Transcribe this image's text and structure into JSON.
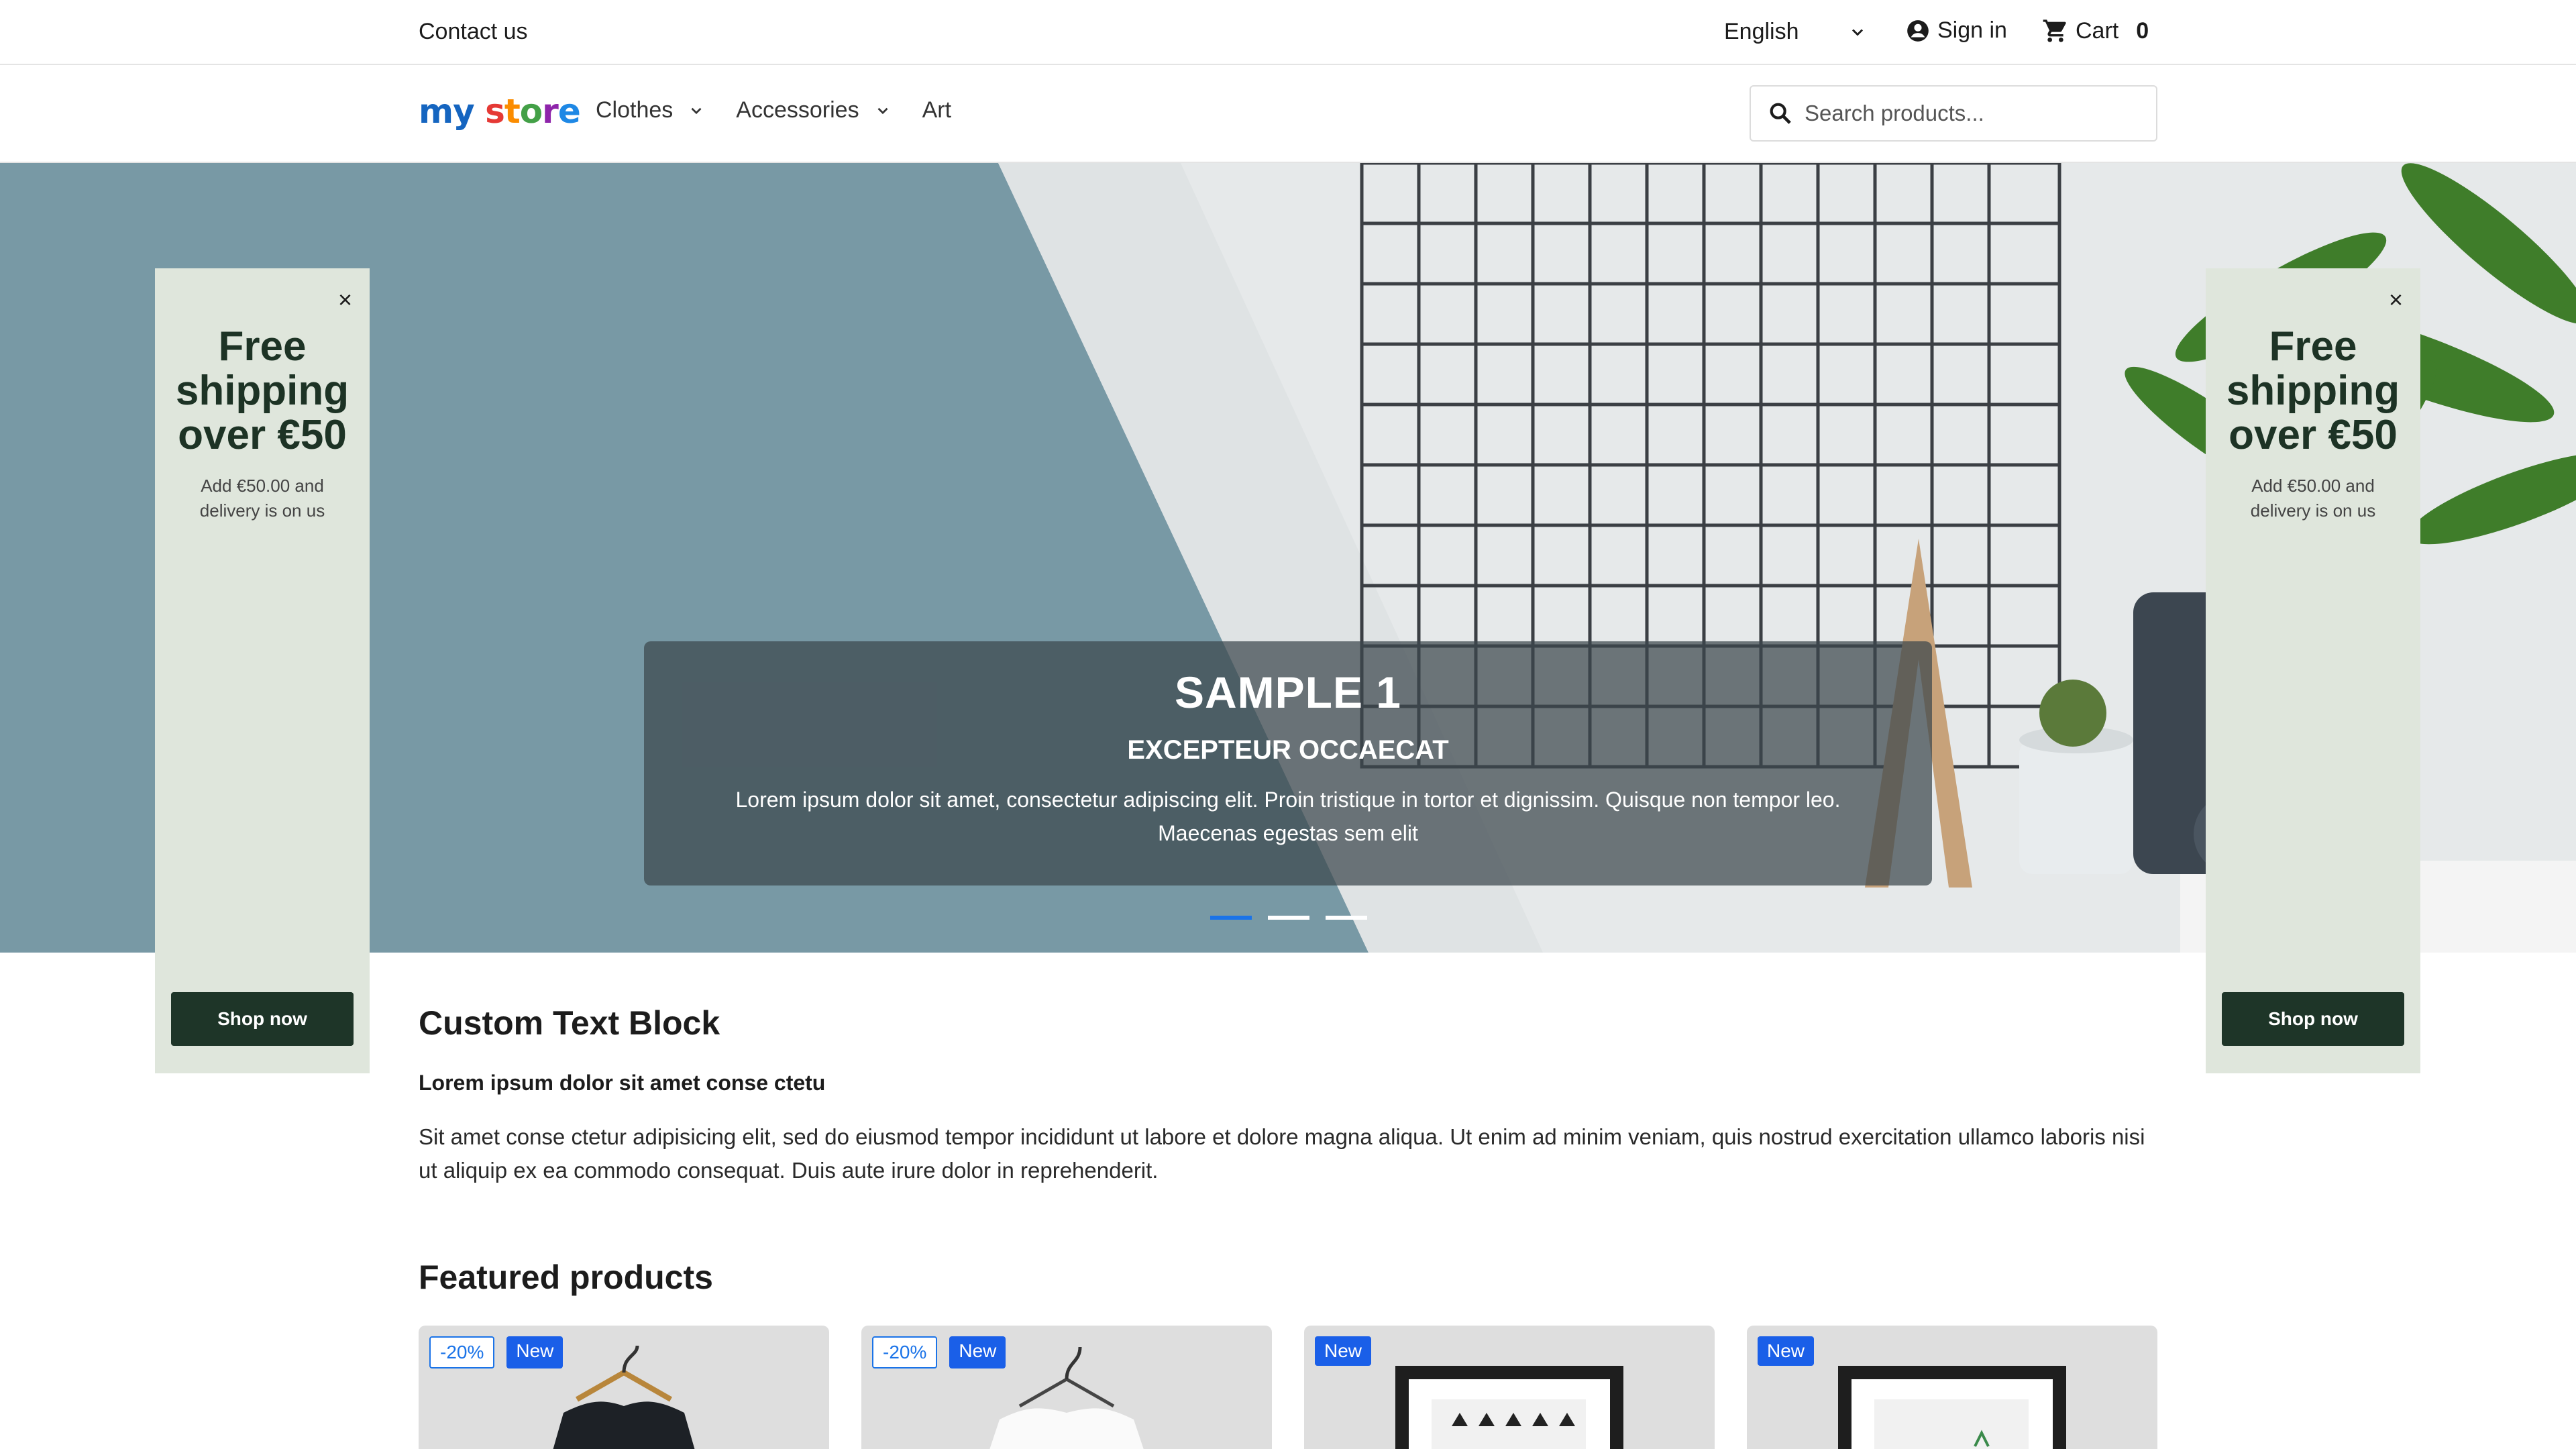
{
  "topbar": {
    "contact": "Contact us",
    "language": "English",
    "signin": "Sign in",
    "cart_label": "Cart",
    "cart_count": "0"
  },
  "header": {
    "logo": "my store",
    "nav": [
      {
        "label": "Clothes",
        "dropdown": true
      },
      {
        "label": "Accessories",
        "dropdown": true
      },
      {
        "label": "Art",
        "dropdown": false
      }
    ],
    "search_placeholder": "Search products..."
  },
  "hero": {
    "title": "SAMPLE 1",
    "subtitle": "EXCEPTEUR OCCAECAT",
    "text": "Lorem ipsum dolor sit amet, consectetur adipiscing elit. Proin tristique in tortor et dignissim. Quisque non tempor leo. Maecenas egestas sem elit",
    "slides": 3,
    "active_slide": 1
  },
  "promo": {
    "headline": "Free shipping over €50",
    "sub": "Add €50.00 and delivery is on us",
    "button": "Shop now",
    "close": "×"
  },
  "custom_block": {
    "title": "Custom Text Block",
    "subtitle": "Lorem ipsum dolor sit amet conse ctetu",
    "body": "Sit amet conse ctetur adipisicing elit, sed do eiusmod tempor incididunt ut labore et dolore magna aliqua. Ut enim ad minim veniam, quis nostrud exercitation ullamco laboris nisi ut aliquip ex ea commodo consequat. Duis aute irure dolor in reprehenderit."
  },
  "featured": {
    "title": "Featured products",
    "products": [
      {
        "discount": "-20%",
        "flag": "New"
      },
      {
        "discount": "-20%",
        "flag": "New"
      },
      {
        "discount": "",
        "flag": "New"
      },
      {
        "discount": "",
        "flag": "New"
      }
    ]
  },
  "colors": {
    "accent": "#1a73e8",
    "promo_bg": "#dfe6dc",
    "promo_button": "#1e3528",
    "hero_left": "#7899a5"
  }
}
